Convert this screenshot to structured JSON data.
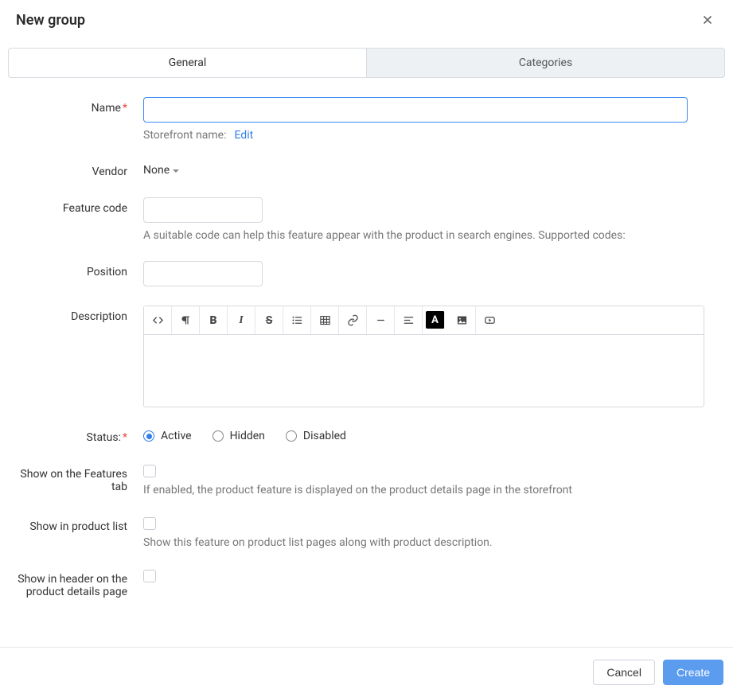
{
  "header": {
    "title": "New group"
  },
  "tabs": {
    "general": "General",
    "categories": "Categories"
  },
  "fields": {
    "name": {
      "label": "Name",
      "subtext": "Storefront name:",
      "edit_link": "Edit"
    },
    "vendor": {
      "label": "Vendor",
      "value": "None"
    },
    "feature_code": {
      "label": "Feature code",
      "hint": "A suitable code can help this feature appear with the product in search engines. Supported codes:"
    },
    "position": {
      "label": "Position"
    },
    "description": {
      "label": "Description"
    },
    "status": {
      "label": "Status:",
      "options": {
        "active": "Active",
        "hidden": "Hidden",
        "disabled": "Disabled"
      }
    },
    "show_features_tab": {
      "label": "Show on the Features tab",
      "hint": "If enabled, the product feature is displayed on the product details page in the storefront"
    },
    "show_product_list": {
      "label": "Show in product list",
      "hint": "Show this feature on product list pages along with product description."
    },
    "show_header_pdp": {
      "label": "Show in header on the product details page"
    }
  },
  "footer": {
    "cancel": "Cancel",
    "create": "Create"
  }
}
